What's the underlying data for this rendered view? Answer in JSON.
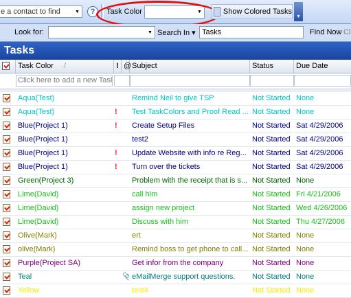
{
  "toolbar": {
    "contact_placeholder": "e a contact to find",
    "help_glyph": "?",
    "task_color_label": "Task Color",
    "task_color_value": "",
    "show_colored_label": "Show Colored Tasks",
    "dropdown_glyph": "▼"
  },
  "findbar": {
    "look_for_label": "Look for:",
    "look_for_value": "",
    "search_in_label": "Search In ▾",
    "search_in_value": "Tasks",
    "find_now_label": "Find Now",
    "clear_label": "Cl"
  },
  "pane": {
    "title": "Tasks"
  },
  "columns": {
    "icon": "",
    "task_color": "Task Color",
    "sort_glyph": "/",
    "importance": "!",
    "attachment": "",
    "subject": "Subject",
    "status": "Status",
    "due_date": "Due Date"
  },
  "new_row": {
    "placeholder": "Click here to add a new Task"
  },
  "colors": {
    "aqua": "#00c8c8",
    "blue": "#000080",
    "green": "#006400",
    "lime": "#19c019",
    "olive": "#808000",
    "purple": "#800080",
    "teal": "#008080",
    "yellow": "#f0f000",
    "imp": "#e02020"
  },
  "tasks": [
    {
      "color_name": "Aqua(Test)",
      "color": "#00c8c8",
      "imp": "",
      "att": "",
      "subject": "Remind Neil to give TSP",
      "status": "Not Started",
      "due": "None"
    },
    {
      "color_name": "Aqua(Test)",
      "color": "#00c8c8",
      "imp": "!",
      "att": "",
      "subject": "Test TaskColors and Proof Read ...",
      "status": "Not Started",
      "due": "None"
    },
    {
      "color_name": "Blue(Project 1)",
      "color": "#000080",
      "imp": "!",
      "att": "",
      "subject": "Create Setup Files",
      "status": "Not Started",
      "due": "Sat 4/29/2006"
    },
    {
      "color_name": "Blue(Project 1)",
      "color": "#000080",
      "imp": "",
      "att": "",
      "subject": "test2",
      "status": "Not Started",
      "due": "Sat 4/29/2006"
    },
    {
      "color_name": "Blue(Project 1)",
      "color": "#000080",
      "imp": "!",
      "att": "",
      "subject": "Update Website with info re Reg...",
      "status": "Not Started",
      "due": "Sat 4/29/2006"
    },
    {
      "color_name": "Blue(Project 1)",
      "color": "#000080",
      "imp": "!",
      "att": "",
      "subject": "Turn over the tickets",
      "status": "Not Started",
      "due": "Sat 4/29/2006"
    },
    {
      "color_name": "Green(Project 3)",
      "color": "#006400",
      "imp": "",
      "att": "",
      "subject": "Problem with the receipt that is s...",
      "status": "Not Started",
      "due": "None"
    },
    {
      "color_name": "Lime(David)",
      "color": "#19c019",
      "imp": "",
      "att": "",
      "subject": "call him",
      "status": "Not Started",
      "due": "Fri 4/21/2006"
    },
    {
      "color_name": "Lime(David)",
      "color": "#19c019",
      "imp": "",
      "att": "",
      "subject": "assign new project",
      "status": "Not Started",
      "due": "Wed 4/26/2006"
    },
    {
      "color_name": "Lime(David)",
      "color": "#19c019",
      "imp": "",
      "att": "",
      "subject": "Discuss with him",
      "status": "Not Started",
      "due": "Thu 4/27/2006"
    },
    {
      "color_name": "Olive(Mark)",
      "color": "#808000",
      "imp": "",
      "att": "",
      "subject": "ert",
      "status": "Not Started",
      "due": "None"
    },
    {
      "color_name": "olive(Mark)",
      "color": "#808000",
      "imp": "",
      "att": "",
      "subject": "Remind boss to get phone to call...",
      "status": "Not Started",
      "due": "None"
    },
    {
      "color_name": "Purple(Project SA)",
      "color": "#800080",
      "imp": "",
      "att": "",
      "subject": "Get infor from the company",
      "status": "Not Started",
      "due": "None"
    },
    {
      "color_name": "Teal",
      "color": "#008080",
      "imp": "",
      "att": "📎",
      "subject": "eMailMerge support questions.",
      "status": "Not Started",
      "due": "None"
    },
    {
      "color_name": "Yellow",
      "color": "#f0f000",
      "imp": "",
      "att": "",
      "subject": "test4",
      "status": "Not Started",
      "due": "None"
    }
  ]
}
